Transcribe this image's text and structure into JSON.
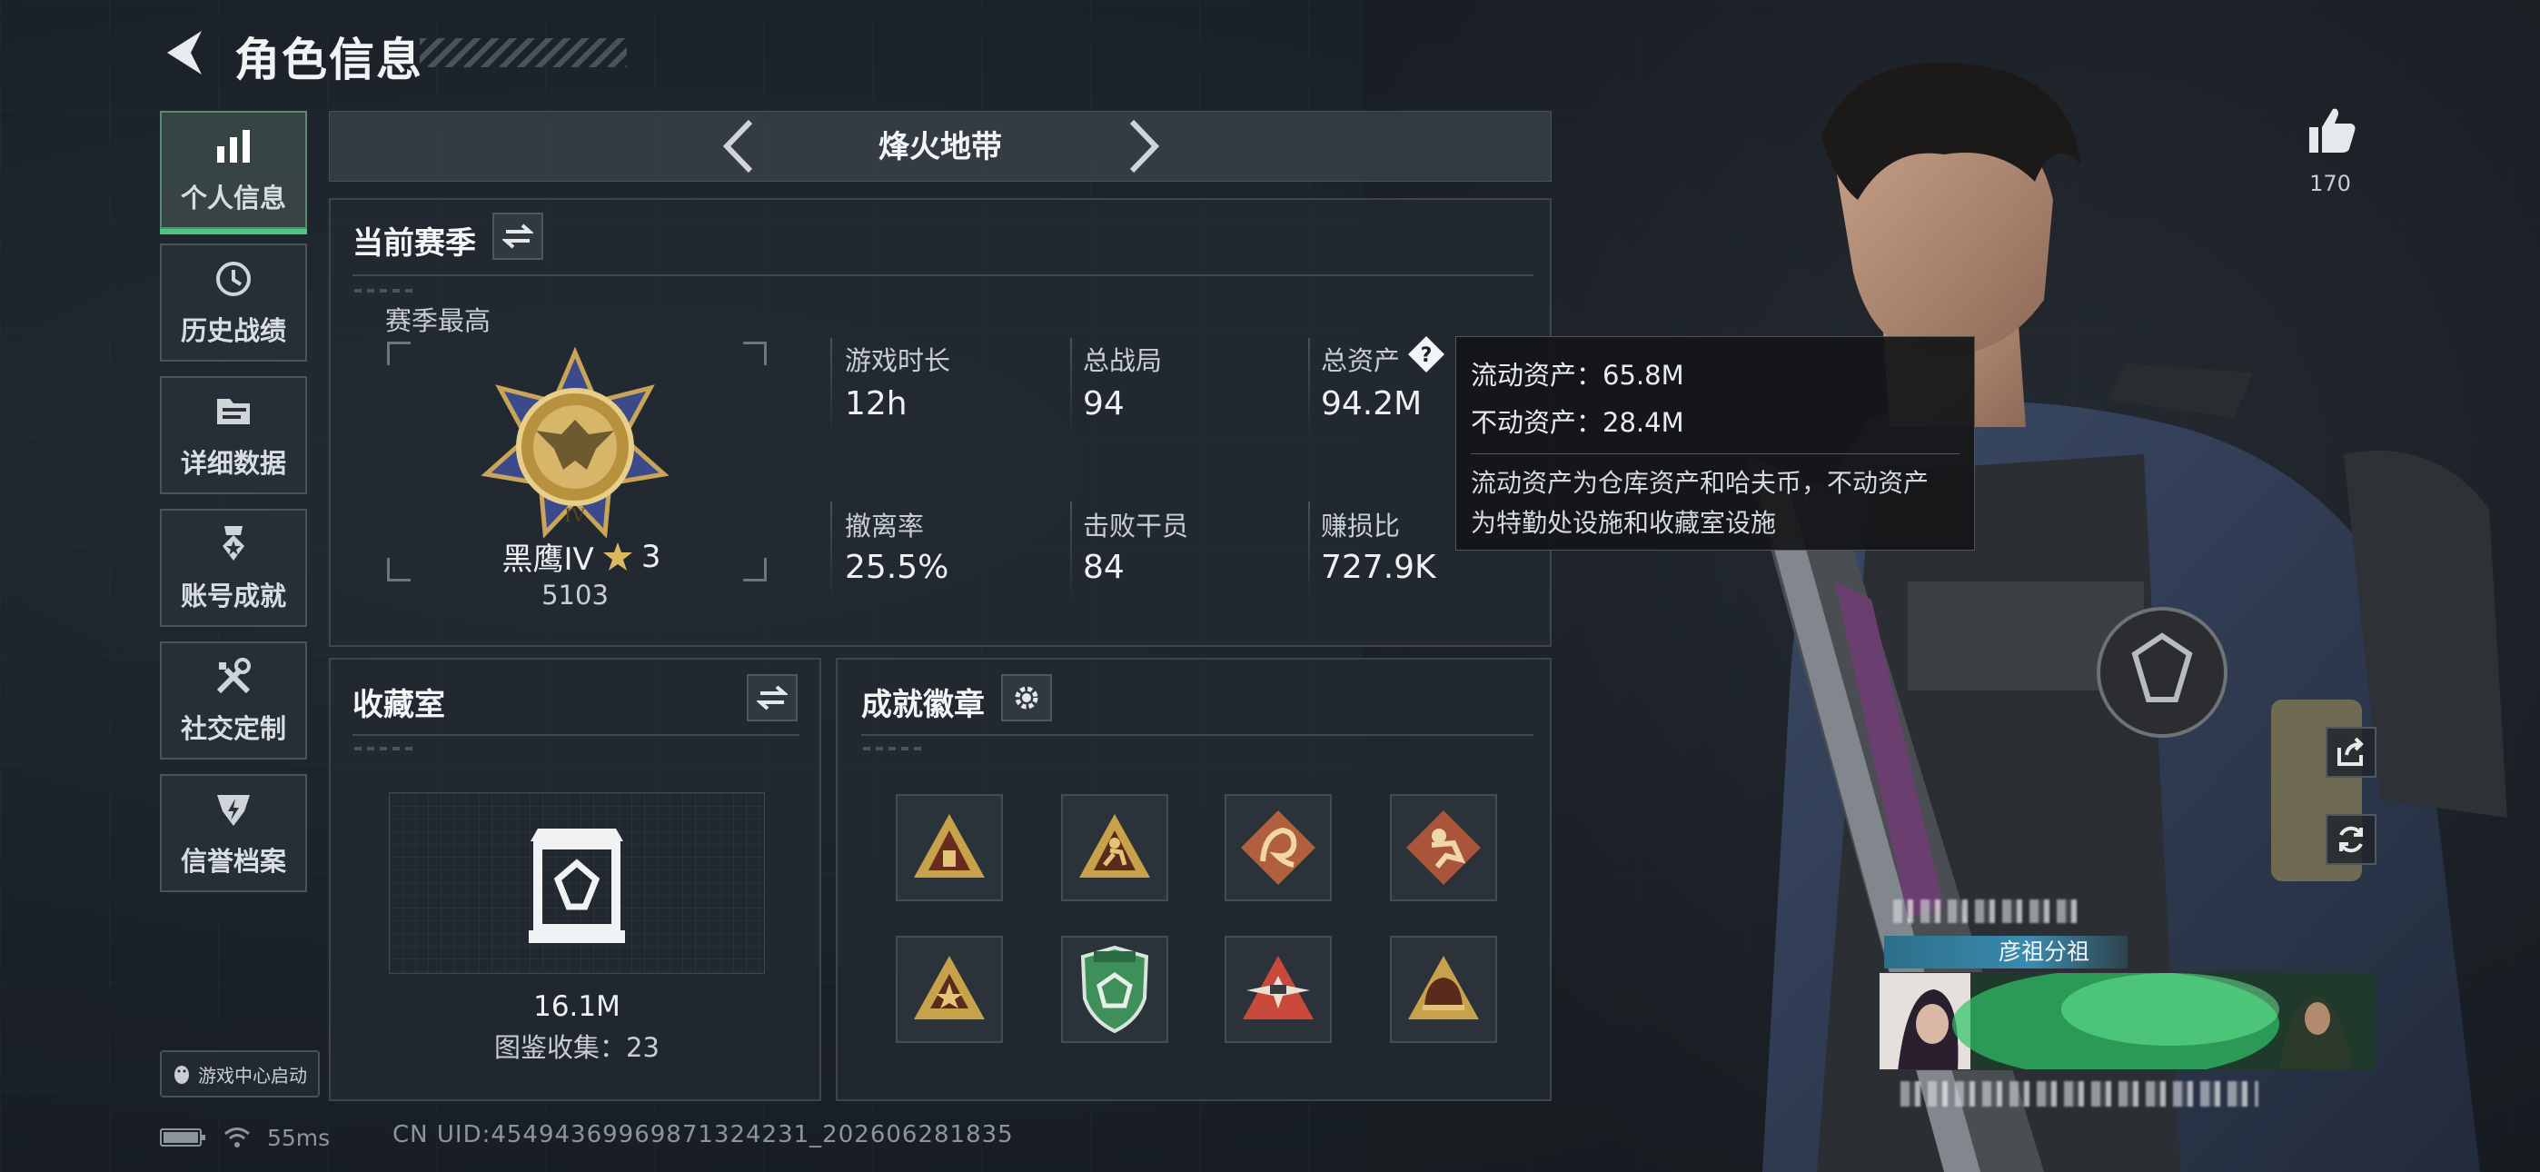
{
  "header": {
    "title": "角色信息"
  },
  "sidebar": {
    "items": [
      {
        "label": "个人信息",
        "icon": "bar-chart-icon",
        "active": true
      },
      {
        "label": "历史战绩",
        "icon": "history-clock-icon",
        "active": false
      },
      {
        "label": "详细数据",
        "icon": "folder-data-icon",
        "active": false
      },
      {
        "label": "账号成就",
        "icon": "achievement-medal-icon",
        "active": false
      },
      {
        "label": "社交定制",
        "icon": "tools-icon",
        "active": false
      },
      {
        "label": "信誉档案",
        "icon": "credit-badge-icon",
        "active": false
      }
    ],
    "game_center": "游戏中心启动"
  },
  "mode_selector": {
    "name": "烽火地带"
  },
  "season": {
    "title": "当前赛季",
    "best_label": "赛季最高",
    "rank_name": "黑鹰IV",
    "rank_stars": "3",
    "rank_score": "5103",
    "stats": [
      {
        "label": "游戏时长",
        "value": "12h"
      },
      {
        "label": "总战局",
        "value": "94"
      },
      {
        "label": "总资产",
        "value": "94.2M"
      },
      {
        "label": "撤离率",
        "value": "25.5%"
      },
      {
        "label": "击败干员",
        "value": "84"
      },
      {
        "label": "赚损比",
        "value": "727.9K"
      }
    ]
  },
  "tooltip": {
    "liquid": "流动资产：65.8M",
    "fixed": "不动资产：28.4M",
    "desc_line1": "流动资产为仓库资产和哈夫币，不动资产",
    "desc_line2": "为特勤处设施和收藏室设施"
  },
  "vault": {
    "title": "收藏室",
    "value": "16.1M",
    "collection": "图鉴收集：23"
  },
  "badges": {
    "title": "成就徽章",
    "items": [
      {
        "icon": "pyramid-badge-icon",
        "color": "#c8a24a"
      },
      {
        "icon": "runner-badge-icon",
        "color": "#c8a24a"
      },
      {
        "icon": "dragon-badge-icon",
        "color": "#b0603c"
      },
      {
        "icon": "soldier-badge-icon",
        "color": "#b0603c"
      },
      {
        "icon": "triangle-star-badge-icon",
        "color": "#c8a24a"
      },
      {
        "icon": "green-shield-badge-icon",
        "color": "#3f8f5a"
      },
      {
        "icon": "red-winged-badge-icon",
        "color": "#c94a3a"
      },
      {
        "icon": "helmet-badge-icon",
        "color": "#c8a24a"
      }
    ]
  },
  "likes": {
    "count": "170"
  },
  "player_card": {
    "name": "彦祖分祖"
  },
  "footer": {
    "ping": "55ms",
    "uid": "CN UID:4549436996987132423​1_202606281835"
  },
  "colors": {
    "accent_green": "#49c77c",
    "panel_border": "#3d464f",
    "gold": "#c8a24a"
  }
}
